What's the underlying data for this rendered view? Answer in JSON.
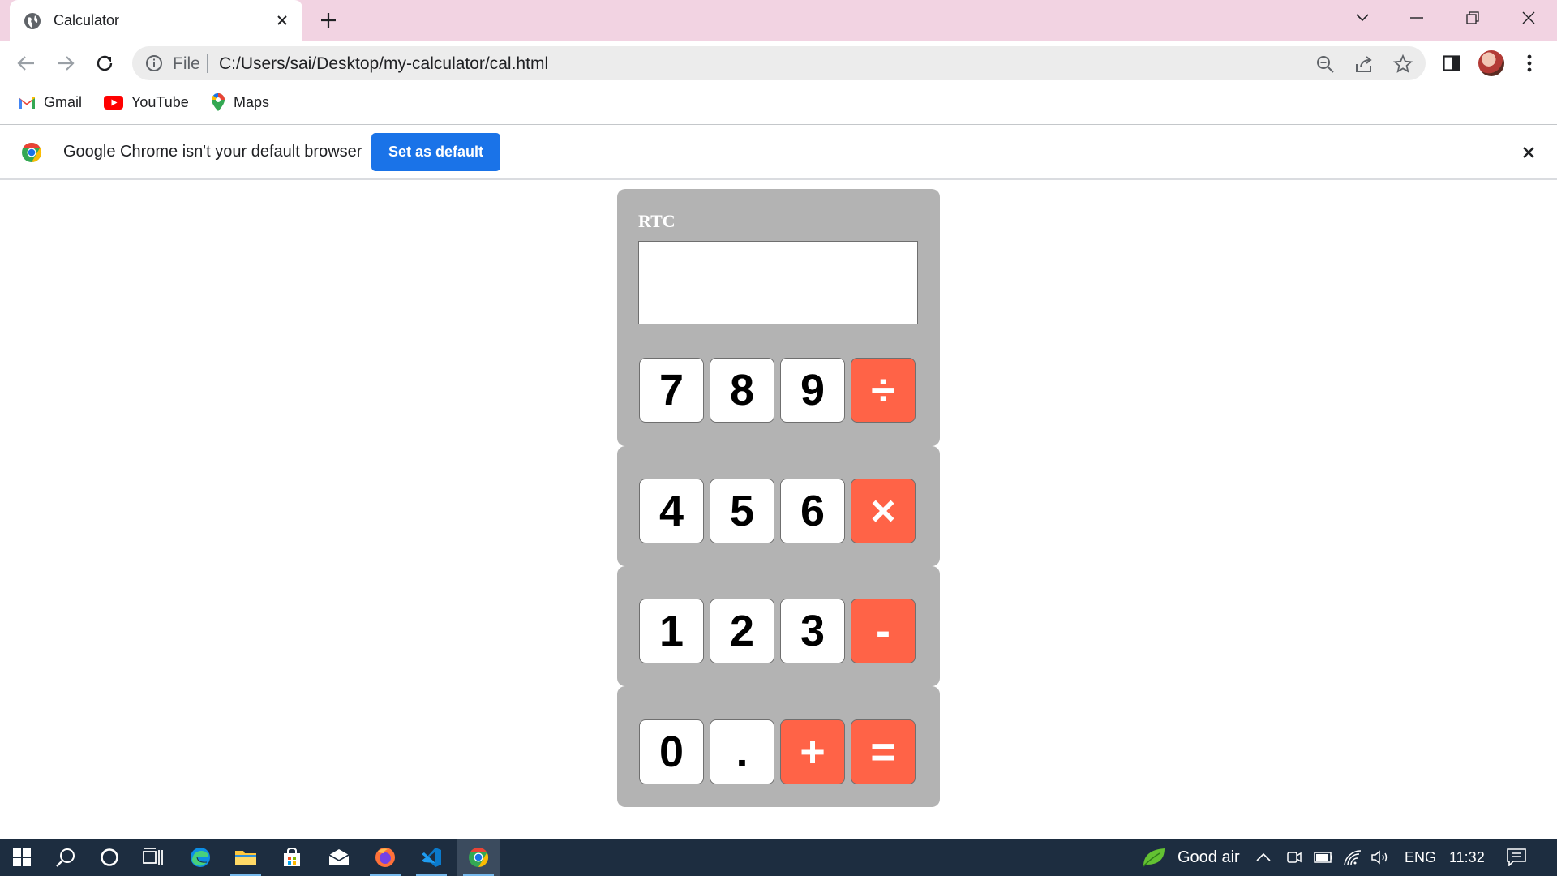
{
  "browser": {
    "tab_title": "Calculator",
    "url_scheme": "File",
    "url": "C:/Users/sai/Desktop/my-calculator/cal.html",
    "bookmarks": [
      {
        "label": "Gmail",
        "icon": "gmail-icon"
      },
      {
        "label": "YouTube",
        "icon": "youtube-icon"
      },
      {
        "label": "Maps",
        "icon": "maps-icon"
      }
    ],
    "infobar": {
      "message": "Google Chrome isn't your default browser",
      "button_label": "Set as default"
    }
  },
  "calculator": {
    "title": "RTC",
    "display_value": "",
    "keys": [
      [
        "7",
        "8",
        "9",
        "÷"
      ],
      [
        "4",
        "5",
        "6",
        "×"
      ],
      [
        "1",
        "2",
        "3",
        "-"
      ],
      [
        "0",
        ".",
        "+",
        "="
      ]
    ]
  },
  "taskbar": {
    "weather_text": "Good air",
    "language": "ENG",
    "time": "11:32"
  },
  "colors": {
    "operator_key": "#ff6347",
    "calculator_body": "#b3b3b3",
    "tab_strip": "#f2d3e2",
    "primary_button": "#1a73e8",
    "taskbar": "#1d2d40"
  }
}
